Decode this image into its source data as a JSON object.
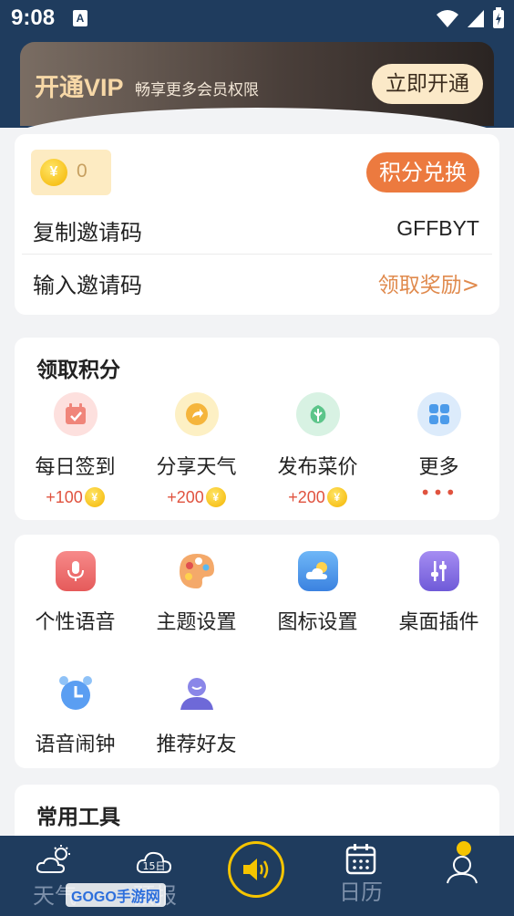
{
  "status_bar": {
    "time": "9:08",
    "notification_icon": "A"
  },
  "vip": {
    "title": "开通VIP",
    "subtitle": "畅享更多会员权限",
    "button": "立即开通"
  },
  "points": {
    "coin_symbol": "¥",
    "balance": "0",
    "exchange_button": "积分兑换",
    "copy_invite_label": "复制邀请码",
    "invite_code": "GFFBYT",
    "enter_invite_label": "输入邀请码",
    "claim_reward_link": "领取奖励>"
  },
  "earn_points": {
    "title": "领取积分",
    "items": [
      {
        "label": "每日签到",
        "reward": "+100",
        "icon": "calendar-check-icon"
      },
      {
        "label": "分享天气",
        "reward": "+200",
        "icon": "share-arrow-icon"
      },
      {
        "label": "发布菜价",
        "reward": "+200",
        "icon": "vegetable-icon"
      },
      {
        "label": "更多",
        "reward": "•••",
        "icon": "grid-more-icon"
      }
    ]
  },
  "features": {
    "items": [
      {
        "label": "个性语音",
        "icon": "microphone-icon"
      },
      {
        "label": "主题设置",
        "icon": "palette-icon"
      },
      {
        "label": "图标设置",
        "icon": "cloud-sun-icon"
      },
      {
        "label": "桌面插件",
        "icon": "sliders-icon"
      },
      {
        "label": "语音闹钟",
        "icon": "alarm-clock-icon"
      },
      {
        "label": "推荐好友",
        "icon": "friends-icon"
      }
    ]
  },
  "tools": {
    "title": "常用工具"
  },
  "bottom_nav": {
    "items": [
      {
        "label": "天气",
        "icon": "weather-icon"
      },
      {
        "label": "预报",
        "icon": "forecast-15day-icon",
        "badge": "15日"
      },
      {
        "label": "",
        "icon": "speaker-icon"
      },
      {
        "label": "日历",
        "icon": "calendar-icon"
      },
      {
        "label": "",
        "icon": "profile-icon"
      }
    ]
  },
  "watermark": "GOGO手游网",
  "colors": {
    "header_bg": "#1f3c5e",
    "accent_orange": "#ec7a3f",
    "reward_red": "#e0533f",
    "coin_gold": "#f4b400",
    "vip_gold": "#f7d8a7"
  }
}
